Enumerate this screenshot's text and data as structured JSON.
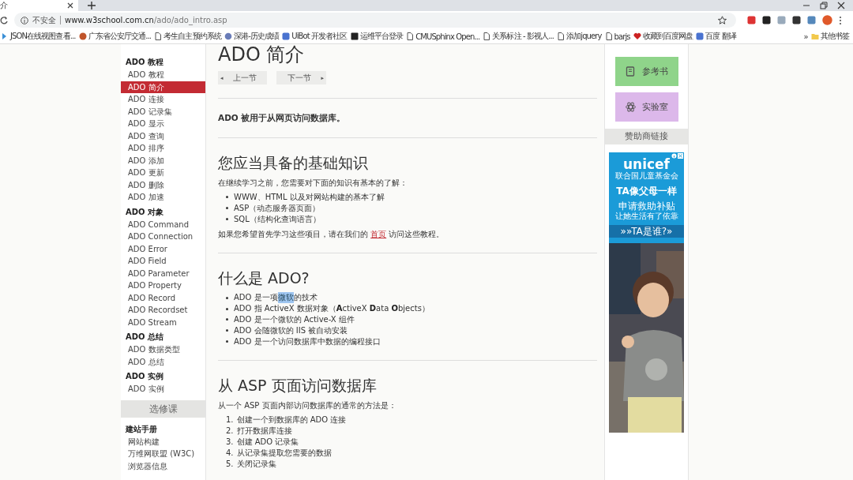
{
  "browser": {
    "tab": {
      "title": "介"
    },
    "address": {
      "security_label": "不安全",
      "url_domain": "www.w3school.com.cn",
      "url_path": "/ado/ado_intro.asp"
    },
    "bookmarks": [
      {
        "label": "JSON在线视图查看...",
        "kind": "arrow"
      },
      {
        "label": "广东省公安厅交通...",
        "kind": "badge"
      },
      {
        "label": "考生自主预约系统",
        "kind": "page"
      },
      {
        "label": "深港-历史成绩",
        "kind": "globe"
      },
      {
        "label": "UiBot 开发者社区",
        "kind": "square"
      },
      {
        "label": "运维平台登录",
        "kind": "dark"
      },
      {
        "label": "CMUSphinx Open...",
        "kind": "page"
      },
      {
        "label": "关系标注 - 影视人...",
        "kind": "page"
      },
      {
        "label": "添加jquery",
        "kind": "page"
      },
      {
        "label": "barjs",
        "kind": "page"
      },
      {
        "label": "收藏到百度网盘",
        "kind": "heart"
      },
      {
        "label": "百度 翻译",
        "kind": "square"
      }
    ],
    "more": "»",
    "other_bookmarks": "其他书签"
  },
  "sidebar": [
    {
      "kind": "group",
      "heading": "ADO 教程",
      "items": [
        {
          "label": "ADO 教程",
          "selected": false
        },
        {
          "label": "ADO 简介",
          "selected": true
        },
        {
          "label": "ADO 连接",
          "selected": false
        },
        {
          "label": "ADO 记录集",
          "selected": false
        },
        {
          "label": "ADO 显示",
          "selected": false
        },
        {
          "label": "ADO 查询",
          "selected": false
        },
        {
          "label": "ADO 排序",
          "selected": false
        },
        {
          "label": "ADO 添加",
          "selected": false
        },
        {
          "label": "ADO 更新",
          "selected": false
        },
        {
          "label": "ADO 删除",
          "selected": false
        },
        {
          "label": "ADO 加速",
          "selected": false
        }
      ]
    },
    {
      "kind": "group",
      "heading": "ADO 对象",
      "items": [
        {
          "label": "ADO Command",
          "selected": false
        },
        {
          "label": "ADO Connection",
          "selected": false
        },
        {
          "label": "ADO Error",
          "selected": false
        },
        {
          "label": "ADO Field",
          "selected": false
        },
        {
          "label": "ADO Parameter",
          "selected": false
        },
        {
          "label": "ADO Property",
          "selected": false
        },
        {
          "label": "ADO Record",
          "selected": false
        },
        {
          "label": "ADO Recordset",
          "selected": false
        },
        {
          "label": "ADO Stream",
          "selected": false
        }
      ]
    },
    {
      "kind": "group",
      "heading": "ADO 总结",
      "items": [
        {
          "label": "ADO 数据类型",
          "selected": false
        },
        {
          "label": "ADO 总结",
          "selected": false
        }
      ]
    },
    {
      "kind": "group",
      "heading": "ADO 实例",
      "items": [
        {
          "label": "ADO 实例",
          "selected": false
        }
      ]
    },
    {
      "kind": "band",
      "label": "选修课"
    },
    {
      "kind": "group",
      "heading": "建站手册",
      "items": [
        {
          "label": "网站构建",
          "selected": false
        },
        {
          "label": "万维网联盟 (W3C)",
          "selected": false
        },
        {
          "label": "浏览器信息",
          "selected": false
        }
      ]
    }
  ],
  "content": {
    "title": "ADO 简介",
    "nav_buttons": [
      {
        "label": "上一节",
        "arrow": "◂",
        "kind": "prev"
      },
      {
        "label": "下一节",
        "arrow": "▸",
        "kind": "next"
      }
    ],
    "lead": "ADO 被用于从网页访问数据库。",
    "sections": [
      {
        "heading": "您应当具备的基础知识",
        "blocks": [
          {
            "kind": "paragraph",
            "text": "在继续学习之前，您需要对下面的知识有基本的了解："
          },
          {
            "kind": "bullets",
            "items": [
              {
                "text": "WWW、HTML 以及对网站构建的基本了解"
              },
              {
                "text": "ASP（动态服务器页面）"
              },
              {
                "text": "SQL（结构化查询语言）"
              }
            ]
          },
          {
            "kind": "link_paragraph",
            "before": "如果您希望首先学习这些项目，请在我们的 ",
            "link": "首页",
            "after": " 访问这些教程。"
          }
        ]
      },
      {
        "heading": "什么是 ADO?",
        "blocks": [
          {
            "kind": "bullets",
            "items": [
              {
                "before": "ADO 是一项",
                "selection": "微软",
                "after": "的技术"
              },
              {
                "text": "ADO 指 ActiveX 数据对象（**A**ctiveX **D**ata **O**bjects）"
              },
              {
                "text": "ADO 是一个微软的 Active-X 组件"
              },
              {
                "text": "ADO 会随微软的 IIS 被自动安装"
              },
              {
                "text": "ADO 是一个访问数据库中数据的编程接口"
              }
            ]
          }
        ]
      },
      {
        "heading": "从 ASP 页面访问数据库",
        "blocks": [
          {
            "kind": "paragraph",
            "text": "从一个 ASP 页面内部访问数据库的通常的方法是："
          },
          {
            "kind": "numbers",
            "items": [
              {
                "number": "1.",
                "text": "创建一个到数据库的 ADO 连接"
              },
              {
                "number": "2.",
                "text": "打开数据库连接"
              },
              {
                "number": "3.",
                "text": "创建 ADO 记录集"
              },
              {
                "number": "4.",
                "text": "从记录集提取您需要的数据"
              },
              {
                "number": "5.",
                "text": "关闭记录集"
              }
            ]
          }
        ]
      }
    ]
  },
  "aside": {
    "buttons": [
      {
        "label": "参考书",
        "color": "#8fd48a",
        "kind": "book"
      },
      {
        "label": "实验室",
        "color": "#dcb8ea",
        "kind": "atom"
      }
    ],
    "sponsor_heading": "赞助商链接",
    "ad": {
      "brand": "unicef",
      "org": "联合国儿童基金会",
      "headline": "TA像父母一样",
      "lines": [
        "申请救助补贴",
        "让她生活有了依靠"
      ],
      "cta": "»»TA是谁?»"
    }
  }
}
